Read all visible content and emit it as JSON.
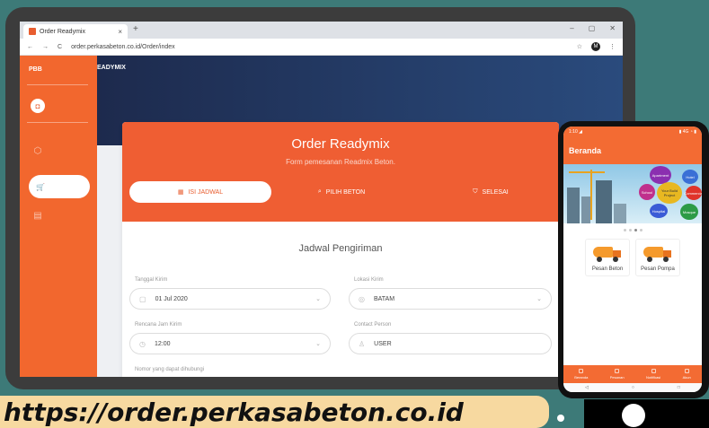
{
  "browser": {
    "tab_title": "Order Readymix",
    "tab_close": "×",
    "new_tab": "+",
    "window_controls": [
      "–",
      "▢",
      "✕"
    ],
    "nav_back": "←",
    "nav_forward": "→",
    "nav_reload": "C",
    "url": "order.perkasabeton.co.id/Order/index",
    "star": "☆",
    "avatar": "M",
    "menu": "⋮"
  },
  "sidebar": {
    "brand": "PBB",
    "logo_text": "◘",
    "items": [
      {
        "icon": "cube-icon",
        "glyph": "⬡"
      },
      {
        "icon": "cart-icon",
        "glyph": "🛒"
      },
      {
        "icon": "list-icon",
        "glyph": "▤"
      }
    ]
  },
  "topbar": {
    "title": "EADYMIX"
  },
  "order": {
    "title": "Order Readymix",
    "subtitle": "Form pemesanan Readmix Beton.",
    "steps": [
      {
        "label": "ISI JADWAL",
        "icon": "calendar-icon",
        "glyph": "▦",
        "active": true
      },
      {
        "label": "PILIH BETON",
        "icon": "search-icon",
        "glyph": "⌕",
        "active": false
      },
      {
        "label": "SELESAI",
        "icon": "cart-icon",
        "glyph": "⛉",
        "active": false
      }
    ],
    "section_title": "Jadwal Pengiriman",
    "fields": {
      "tanggal_label": "Tanggal Kirim",
      "tanggal_value": "01 Jul 2020",
      "lokasi_label": "Lokasi Kirim",
      "lokasi_value": "BATAM",
      "jam_label": "Rencana Jam Kirim",
      "jam_value": "12:00",
      "contact_label": "Contact Person",
      "contact_value": "USER",
      "phone_label": "Nomor yang dapat dihubungi"
    }
  },
  "banner": {
    "text": "https://order.perkasabeton.co.id"
  },
  "phone": {
    "status_left": "1:10 ◢",
    "status_right": "▮ 4G ◔ ▮",
    "title": "Beranda",
    "bubbles": [
      "Apartment",
      "Hotel",
      "School",
      "Your Build Project",
      "Commercial",
      "Hospital",
      "Mosque"
    ],
    "buttons": [
      "Pesan Beton",
      "Pesan Pompa"
    ],
    "bottom_nav": [
      "Beranda",
      "Pesanan",
      "Notifikasi",
      "Akun"
    ],
    "sys_nav": [
      "◁",
      "○",
      "□"
    ]
  },
  "colors": {
    "primary": "#ef5e33",
    "sidebar": "#f2672e",
    "navy": "#1d2a4d"
  }
}
